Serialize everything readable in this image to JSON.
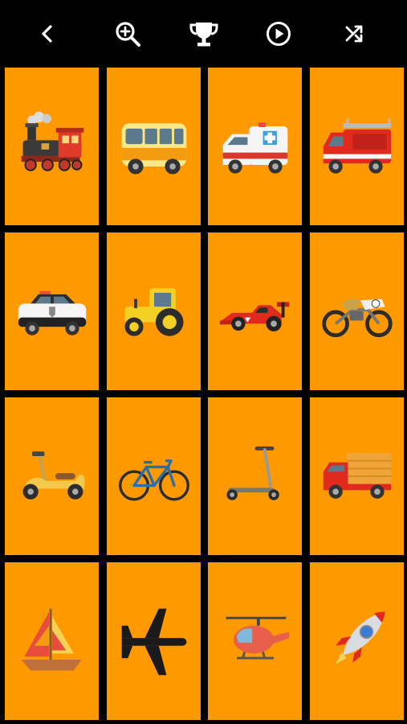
{
  "toolbar": {
    "buttons": [
      {
        "name": "back-button",
        "icon": "chevron-left-icon"
      },
      {
        "name": "zoom-button",
        "icon": "zoom-in-icon"
      },
      {
        "name": "trophy-button",
        "icon": "trophy-icon"
      },
      {
        "name": "play-button",
        "icon": "play-circle-icon"
      },
      {
        "name": "shuffle-button",
        "icon": "shuffle-icon"
      }
    ]
  },
  "colors": {
    "background": "#000000",
    "tile": "#FF9900",
    "icon": "#FFFFFF"
  },
  "grid": {
    "columns": 4,
    "rows": 4,
    "tiles": [
      {
        "name": "tile-locomotive",
        "icon": "locomotive-icon"
      },
      {
        "name": "tile-bus",
        "icon": "bus-icon"
      },
      {
        "name": "tile-ambulance",
        "icon": "ambulance-icon"
      },
      {
        "name": "tile-fire-truck",
        "icon": "fire-truck-icon"
      },
      {
        "name": "tile-police-car",
        "icon": "police-car-icon"
      },
      {
        "name": "tile-tractor",
        "icon": "tractor-icon"
      },
      {
        "name": "tile-race-car",
        "icon": "race-car-icon"
      },
      {
        "name": "tile-motorcycle",
        "icon": "motorcycle-icon"
      },
      {
        "name": "tile-scooter",
        "icon": "scooter-icon"
      },
      {
        "name": "tile-bicycle",
        "icon": "bicycle-icon"
      },
      {
        "name": "tile-kick-scooter",
        "icon": "kick-scooter-icon"
      },
      {
        "name": "tile-delivery-truck",
        "icon": "delivery-truck-icon"
      },
      {
        "name": "tile-sailboat",
        "icon": "sailboat-icon"
      },
      {
        "name": "tile-airplane",
        "icon": "airplane-icon"
      },
      {
        "name": "tile-helicopter",
        "icon": "helicopter-icon"
      },
      {
        "name": "tile-rocket",
        "icon": "rocket-icon"
      }
    ]
  }
}
